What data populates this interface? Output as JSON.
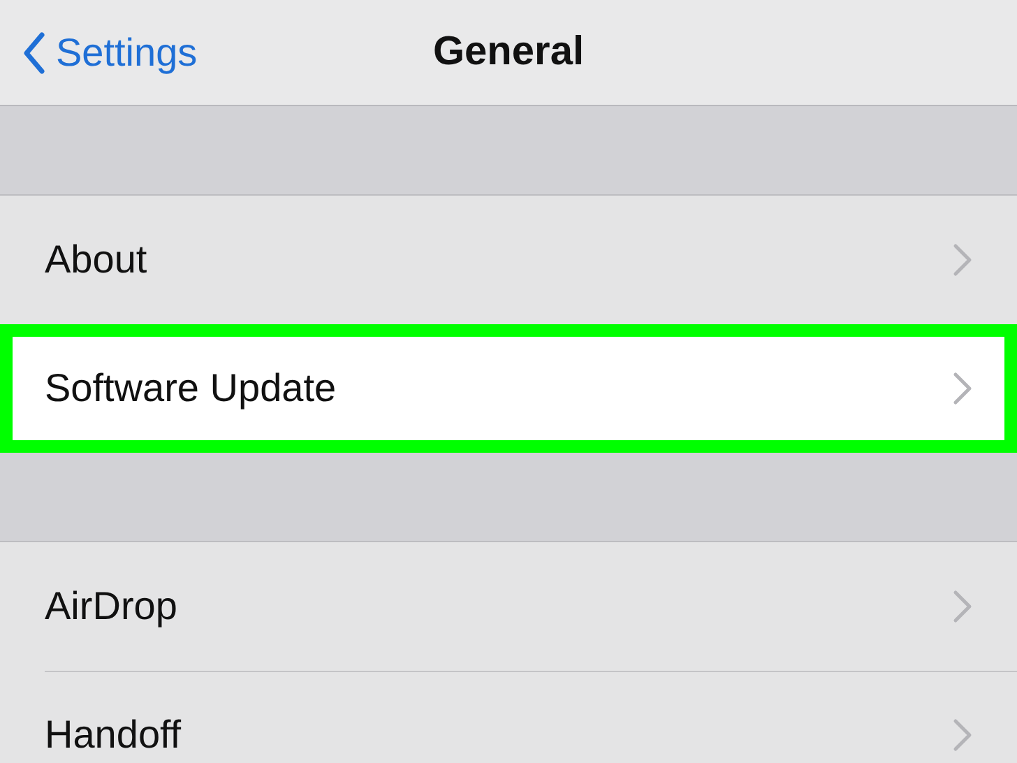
{
  "nav": {
    "back_label": "Settings",
    "title": "General"
  },
  "sections": [
    {
      "items": [
        {
          "label": "About",
          "highlighted": false
        },
        {
          "label": "Software Update",
          "highlighted": true
        }
      ]
    },
    {
      "items": [
        {
          "label": "AirDrop",
          "highlighted": false
        },
        {
          "label": "Handoff",
          "highlighted": false
        }
      ]
    }
  ]
}
